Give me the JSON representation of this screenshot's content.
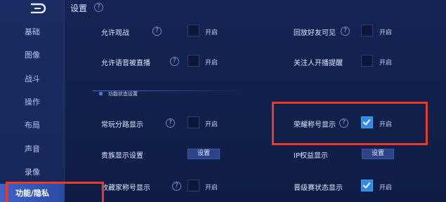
{
  "sidebar": {
    "items": [
      {
        "label": "基础"
      },
      {
        "label": "图像"
      },
      {
        "label": "战斗"
      },
      {
        "label": "操作"
      },
      {
        "label": "布局"
      },
      {
        "label": "声音"
      },
      {
        "label": "录像"
      },
      {
        "label": "功能/隐私",
        "active": true
      }
    ]
  },
  "header": {
    "title": "设置"
  },
  "section": {
    "title": "功能状态设置"
  },
  "settings": {
    "allow_spectate": {
      "label": "允许观战",
      "state": "开启",
      "checked": false
    },
    "replay_friends": {
      "label": "回放好友可见",
      "state": "开启",
      "checked": false
    },
    "allow_voice_stream": {
      "label": "允许语音被直播",
      "state": "开启",
      "checked": false
    },
    "follow_stream_alert": {
      "label": "关注人开播提醒",
      "state": "开启",
      "checked": false
    },
    "lane_display": {
      "label": "常玩分路显示",
      "state": "开启",
      "checked": false
    },
    "honor_title": {
      "label": "荣耀称号显示",
      "state": "开启",
      "checked": true
    },
    "noble_display": {
      "label": "贵族显示设置",
      "button": "设置"
    },
    "ip_benefit": {
      "label": "IP权益显示",
      "button": "设置"
    },
    "collector_title": {
      "label": "收藏家称号显示",
      "state": "开启",
      "checked": false
    },
    "promotion_status": {
      "label": "晋级赛状态显示",
      "state": "开启",
      "checked": true
    }
  },
  "colors": {
    "background": "#0f1d45",
    "sidebar": "#1a2c63",
    "active_tab": "#3d63c6",
    "checkbox_checked": "#2f8ae6",
    "highlight_box": "#ea3b2a"
  }
}
